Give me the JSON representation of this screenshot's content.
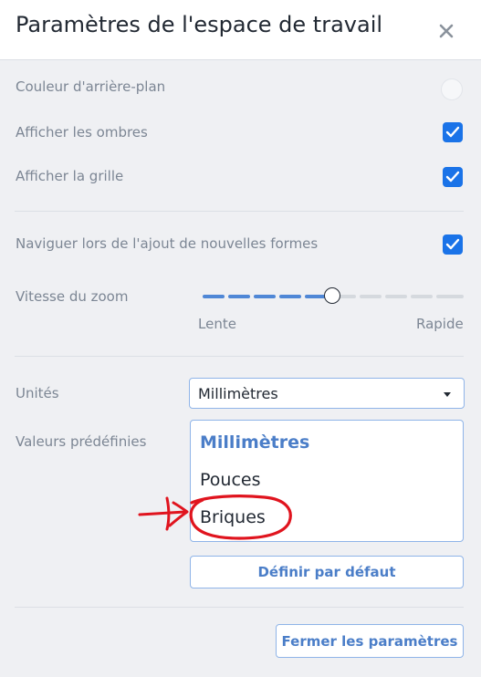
{
  "header": {
    "title": "Paramètres de l'espace de travail",
    "close_icon": "close-icon"
  },
  "settings": {
    "background_color_label": "Couleur d'arrière-plan",
    "background_color": "#f6f7f9",
    "show_shadows_label": "Afficher les ombres",
    "show_shadows": true,
    "show_grid_label": "Afficher la grille",
    "show_grid": true,
    "navigate_label": "Naviguer lors de l'ajout de nouvelles formes",
    "navigate": true,
    "zoom_speed_label": "Vitesse du zoom",
    "zoom_speed_level": 5,
    "zoom_speed_max": 10,
    "zoom_min_label": "Lente",
    "zoom_max_label": "Rapide",
    "units_label": "Unités",
    "units_value": "Millimètres",
    "presets_label": "Valeurs prédéfinies",
    "presets_options": [
      "Millimètres",
      "Pouces",
      "Briques"
    ],
    "presets_selected": "Millimètres",
    "set_default_label": "Définir par défaut",
    "close_settings_label": "Fermer les paramètres"
  },
  "colors": {
    "accent": "#1a73e8",
    "link_text": "#4b7ec8",
    "annotation": "#e0141e"
  }
}
